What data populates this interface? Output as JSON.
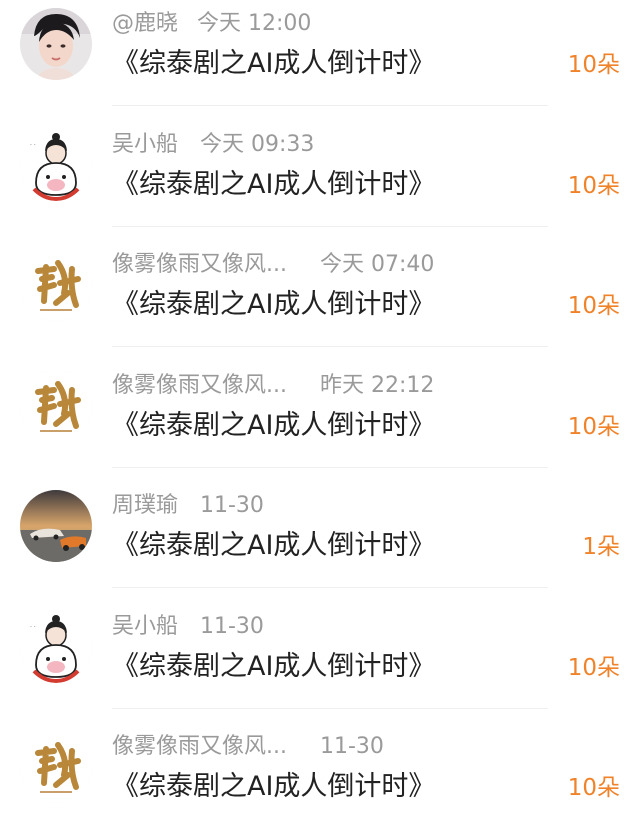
{
  "colors": {
    "name": "#9a9a9a",
    "title": "#222222",
    "flowers": "#f0832a"
  },
  "items": [
    {
      "user": "@鹿晓",
      "time": "今天 12:00",
      "title": "《综泰剧之AI成人倒计时》",
      "flowers": "10朵",
      "avatar_icon": "portrait-photo-icon"
    },
    {
      "user": "吴小船",
      "time": "今天 09:33",
      "title": "《综泰剧之AI成人倒计时》",
      "flowers": "10朵",
      "avatar_icon": "cartoon-girl-icon"
    },
    {
      "user": "像雾像雨又像风...",
      "time": "今天 07:40",
      "title": "《综泰剧之AI成人倒计时》",
      "flowers": "10朵",
      "avatar_icon": "calligraphy-logo-icon"
    },
    {
      "user": "像雾像雨又像风...",
      "time": "昨天 22:12",
      "title": "《综泰剧之AI成人倒计时》",
      "flowers": "10朵",
      "avatar_icon": "calligraphy-logo-icon"
    },
    {
      "user": "周璞瑜",
      "time": "11-30",
      "title": "《综泰剧之AI成人倒计时》",
      "flowers": "1朵",
      "avatar_icon": "race-car-icon"
    },
    {
      "user": "吴小船",
      "time": "11-30",
      "title": "《综泰剧之AI成人倒计时》",
      "flowers": "10朵",
      "avatar_icon": "cartoon-girl-icon"
    },
    {
      "user": "像雾像雨又像风...",
      "time": "11-30",
      "title": "《综泰剧之AI成人倒计时》",
      "flowers": "10朵",
      "avatar_icon": "calligraphy-logo-icon"
    }
  ]
}
